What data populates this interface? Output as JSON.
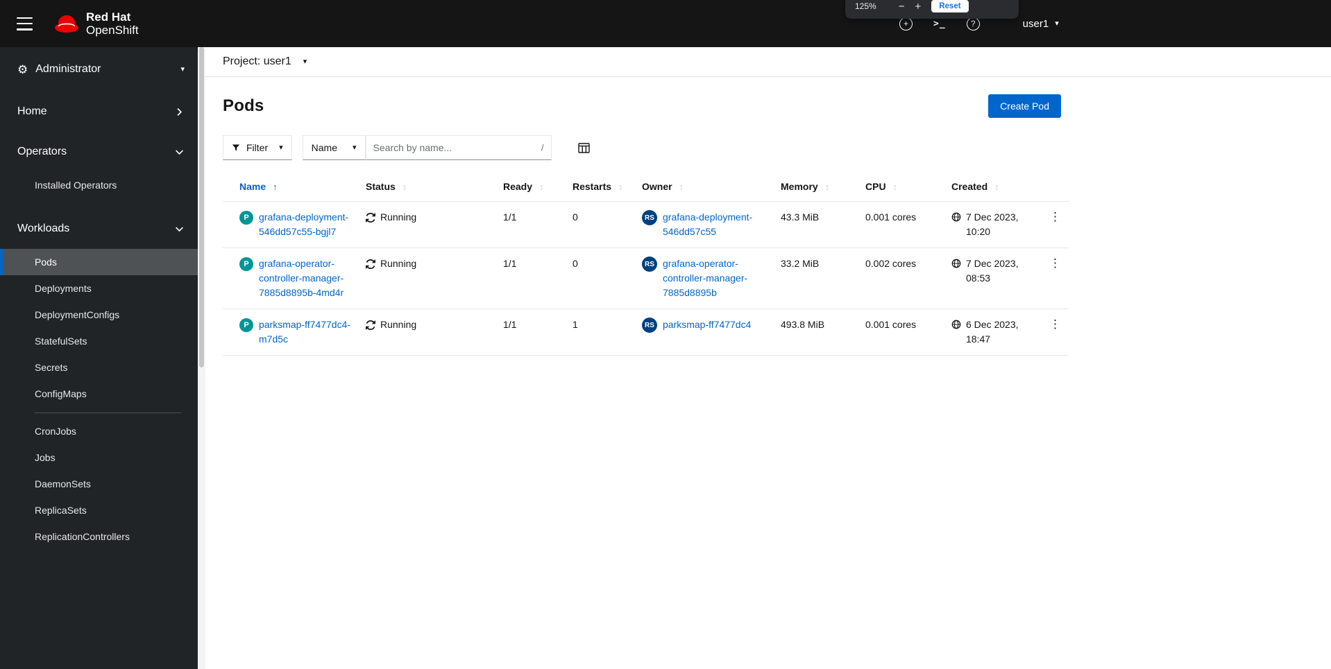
{
  "masthead": {
    "brand_line1": "Red Hat",
    "brand_line2": "OpenShift",
    "user": "user1"
  },
  "zoom_popup": {
    "level": "125%",
    "minus": "−",
    "plus": "+",
    "reset_label": "Reset"
  },
  "icons": {
    "kebab": "⋮",
    "caret_down": "▾",
    "sort_ascending": "↑",
    "sortable": "↕",
    "terminal": ">_",
    "help": "?",
    "plus": "+",
    "gear": "⚙"
  },
  "sidebar": {
    "perspective": "Administrator",
    "home": "Home",
    "operators": "Operators",
    "installed_operators": "Installed Operators",
    "workloads": "Workloads",
    "workloads_items": [
      {
        "label": "Pods",
        "active": true
      },
      {
        "label": "Deployments"
      },
      {
        "label": "DeploymentConfigs"
      },
      {
        "label": "StatefulSets"
      },
      {
        "label": "Secrets"
      },
      {
        "label": "ConfigMaps"
      },
      {
        "label": "CronJobs",
        "divider_before": true
      },
      {
        "label": "Jobs"
      },
      {
        "label": "DaemonSets"
      },
      {
        "label": "ReplicaSets"
      },
      {
        "label": "ReplicationControllers"
      }
    ]
  },
  "project_bar": {
    "label": "Project: user1"
  },
  "page": {
    "title": "Pods",
    "create_button": "Create Pod"
  },
  "toolbar": {
    "filter_label": "Filter",
    "attribute_label": "Name",
    "search_placeholder": "Search by name...",
    "search_shortcut": "/"
  },
  "table": {
    "pod_badge": "P",
    "replicaset_badge": "RS",
    "columns": [
      {
        "label": "Name",
        "sorted": true
      },
      {
        "label": "Status"
      },
      {
        "label": "Ready"
      },
      {
        "label": "Restarts"
      },
      {
        "label": "Owner"
      },
      {
        "label": "Memory"
      },
      {
        "label": "CPU"
      },
      {
        "label": "Created"
      }
    ],
    "rows": [
      {
        "name": "grafana-deployment-546dd57c55-bgjl7",
        "status": "Running",
        "ready": "1/1",
        "restarts": "0",
        "owner": "grafana-deployment-546dd57c55",
        "memory": "43.3 MiB",
        "cpu": "0.001 cores",
        "created": "7 Dec 2023, 10:20"
      },
      {
        "name": "grafana-operator-controller-manager-7885d8895b-4md4r",
        "status": "Running",
        "ready": "1/1",
        "restarts": "0",
        "owner": "grafana-operator-controller-manager-7885d8895b",
        "memory": "33.2 MiB",
        "cpu": "0.002 cores",
        "created": "7 Dec 2023, 08:53"
      },
      {
        "name": "parksmap-ff7477dc4-m7d5c",
        "status": "Running",
        "ready": "1/1",
        "restarts": "1",
        "owner": "parksmap-ff7477dc4",
        "memory": "493.8 MiB",
        "cpu": "0.001 cores",
        "created": "6 Dec 2023, 18:47"
      }
    ]
  },
  "colors": {
    "brand_red": "#ee0000",
    "link_blue": "#0066cc",
    "pod_badge": "#009596",
    "replicaset_badge": "#004080",
    "masthead_bg": "#151515",
    "sidebar_bg": "#212427",
    "nav_active_bg": "#4f5255",
    "nav_active_border": "#0066cc",
    "primary_button": "#0066cc"
  }
}
